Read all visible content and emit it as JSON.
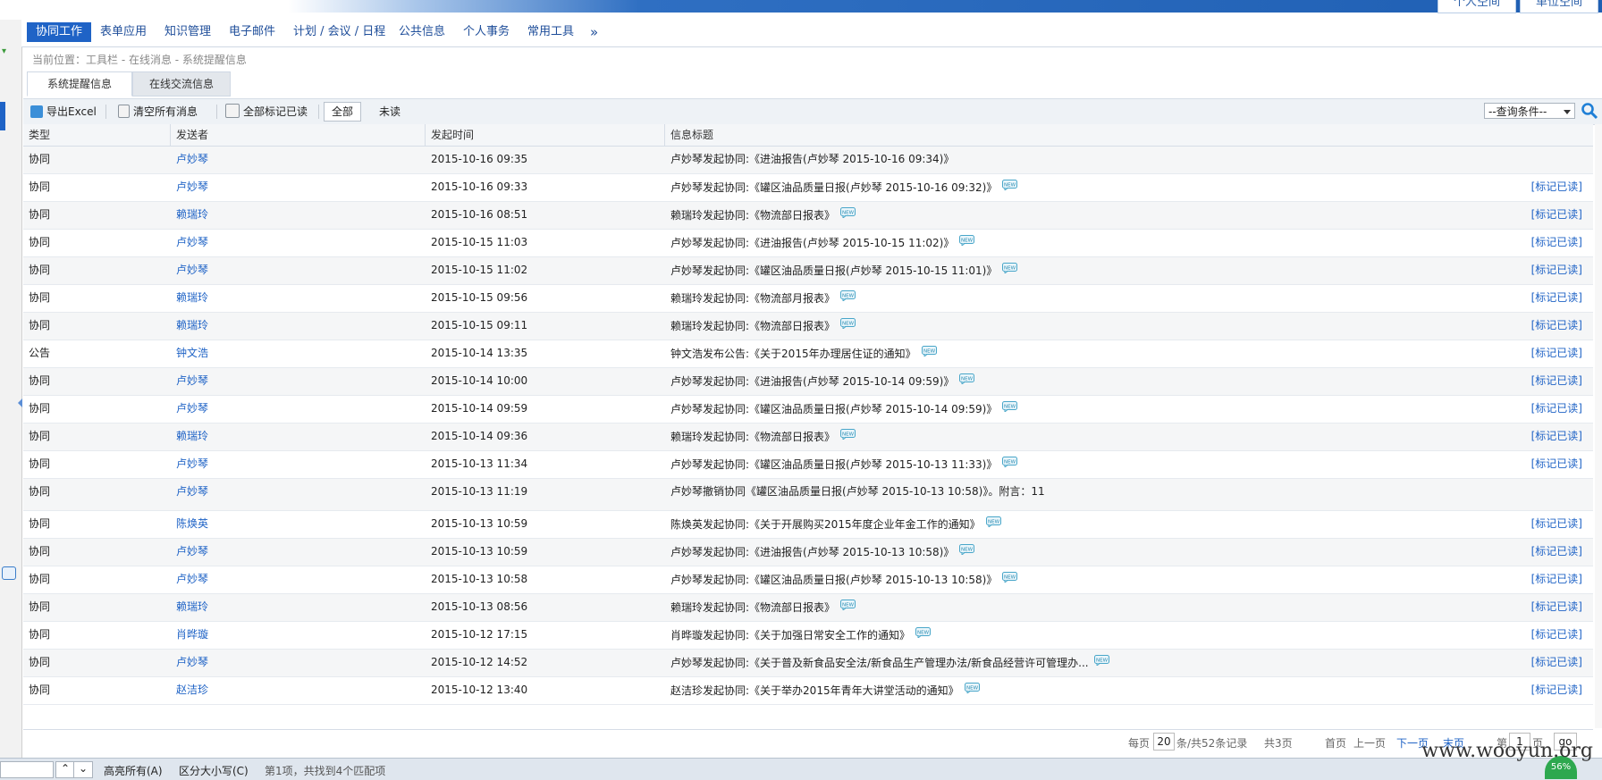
{
  "top": {
    "space_tabs": [
      "个人空间",
      "单位空间"
    ]
  },
  "nav": {
    "items": [
      "协同工作",
      "表单应用",
      "知识管理",
      "电子邮件",
      "计划 / 会议 / 日程",
      "公共信息",
      "个人事务",
      "常用工具"
    ],
    "more": "»"
  },
  "breadcrumb": "当前位置：工具栏 - 在线消息 - 系统提醒信息",
  "subtabs": [
    "系统提醒信息",
    "在线交流信息"
  ],
  "toolbar": {
    "export": "导出Excel",
    "clear": "清空所有消息",
    "mark_all": "全部标记已读",
    "filter_all": "全部",
    "filter_unread": "未读",
    "query_placeholder": "--查询条件--"
  },
  "table": {
    "headers": [
      "类型",
      "发送者",
      "发起时间",
      "信息标题"
    ],
    "mark_label": "[标记已读]",
    "rows": [
      {
        "type": "协同",
        "sender": "卢妙琴",
        "time": "2015-10-16 09:35",
        "title": "卢妙琴发起协同:《进油报告(卢妙琴 2015-10-16 09:34)》",
        "is_new": false,
        "mark": false
      },
      {
        "type": "协同",
        "sender": "卢妙琴",
        "time": "2015-10-16 09:33",
        "title": "卢妙琴发起协同:《罐区油品质量日报(卢妙琴 2015-10-16 09:32)》",
        "is_new": true,
        "mark": true
      },
      {
        "type": "协同",
        "sender": "赖瑞玲",
        "time": "2015-10-16 08:51",
        "title": "赖瑞玲发起协同:《物流部日报表》",
        "is_new": true,
        "mark": true
      },
      {
        "type": "协同",
        "sender": "卢妙琴",
        "time": "2015-10-15 11:03",
        "title": "卢妙琴发起协同:《进油报告(卢妙琴 2015-10-15 11:02)》",
        "is_new": true,
        "mark": true
      },
      {
        "type": "协同",
        "sender": "卢妙琴",
        "time": "2015-10-15 11:02",
        "title": "卢妙琴发起协同:《罐区油品质量日报(卢妙琴 2015-10-15 11:01)》",
        "is_new": true,
        "mark": true
      },
      {
        "type": "协同",
        "sender": "赖瑞玲",
        "time": "2015-10-15 09:56",
        "title": "赖瑞玲发起协同:《物流部月报表》",
        "is_new": true,
        "mark": true
      },
      {
        "type": "协同",
        "sender": "赖瑞玲",
        "time": "2015-10-15 09:11",
        "title": "赖瑞玲发起协同:《物流部日报表》",
        "is_new": true,
        "mark": true
      },
      {
        "type": "公告",
        "sender": "钟文浩",
        "time": "2015-10-14 13:35",
        "title": "钟文浩发布公告:《关于2015年办理居住证的通知》",
        "is_new": true,
        "mark": true
      },
      {
        "type": "协同",
        "sender": "卢妙琴",
        "time": "2015-10-14 10:00",
        "title": "卢妙琴发起协同:《进油报告(卢妙琴 2015-10-14 09:59)》",
        "is_new": true,
        "mark": true
      },
      {
        "type": "协同",
        "sender": "卢妙琴",
        "time": "2015-10-14 09:59",
        "title": "卢妙琴发起协同:《罐区油品质量日报(卢妙琴 2015-10-14 09:59)》",
        "is_new": true,
        "mark": true
      },
      {
        "type": "协同",
        "sender": "赖瑞玲",
        "time": "2015-10-14 09:36",
        "title": "赖瑞玲发起协同:《物流部日报表》",
        "is_new": true,
        "mark": true
      },
      {
        "type": "协同",
        "sender": "卢妙琴",
        "time": "2015-10-13 11:34",
        "title": "卢妙琴发起协同:《罐区油品质量日报(卢妙琴 2015-10-13 11:33)》",
        "is_new": true,
        "mark": true
      },
      {
        "type": "协同",
        "sender": "卢妙琴",
        "time": "2015-10-13 11:19",
        "title": " 卢妙琴撤销协同《罐区油品质量日报(卢妙琴 2015-10-13 10:58)》。附言：11",
        "is_new": false,
        "mark": false,
        "tall": true
      },
      {
        "type": "协同",
        "sender": "陈焕英",
        "time": "2015-10-13 10:59",
        "title": "陈焕英发起协同:《关于开展购买2015年度企业年金工作的通知》",
        "is_new": true,
        "mark": true
      },
      {
        "type": "协同",
        "sender": "卢妙琴",
        "time": "2015-10-13 10:59",
        "title": "卢妙琴发起协同:《进油报告(卢妙琴 2015-10-13 10:58)》",
        "is_new": true,
        "mark": true
      },
      {
        "type": "协同",
        "sender": "卢妙琴",
        "time": "2015-10-13 10:58",
        "title": "卢妙琴发起协同:《罐区油品质量日报(卢妙琴 2015-10-13 10:58)》",
        "is_new": true,
        "mark": true
      },
      {
        "type": "协同",
        "sender": "赖瑞玲",
        "time": "2015-10-13 08:56",
        "title": "赖瑞玲发起协同:《物流部日报表》",
        "is_new": true,
        "mark": true
      },
      {
        "type": "协同",
        "sender": "肖晔璇",
        "time": "2015-10-12 17:15",
        "title": "肖晔璇发起协同:《关于加强日常安全工作的通知》",
        "is_new": true,
        "mark": true
      },
      {
        "type": "协同",
        "sender": "卢妙琴",
        "time": "2015-10-12 14:52",
        "title": "卢妙琴发起协同:《关于普及新食品安全法/新食品生产管理办法/新食品经营许可管理办...",
        "is_new": true,
        "mark": true
      },
      {
        "type": "协同",
        "sender": "赵洁珍",
        "time": "2015-10-12 13:40",
        "title": "赵洁珍发起协同:《关于举办2015年青年大讲堂活动的通知》",
        "is_new": true,
        "mark": true
      }
    ]
  },
  "pager": {
    "per_page_prefix": "每页",
    "per_page": "20",
    "summary": "条/共52条记录",
    "pages": "共3页",
    "first": "首页",
    "prev": "上一页",
    "next": "下一页",
    "last": "末页",
    "goto_prefix": "第",
    "goto_value": "1",
    "goto_suffix": "页",
    "go": "go"
  },
  "findbar": {
    "highlight_all": "高亮所有(A)",
    "match_case": "区分大小写(C)",
    "status": "第1项，共找到4个匹配项"
  },
  "watermark": "www.wooyun.org",
  "network": "56%",
  "colors": {
    "accent": "#1f63c6",
    "link": "#1f63c6",
    "nav_bg": "#ffffff"
  }
}
